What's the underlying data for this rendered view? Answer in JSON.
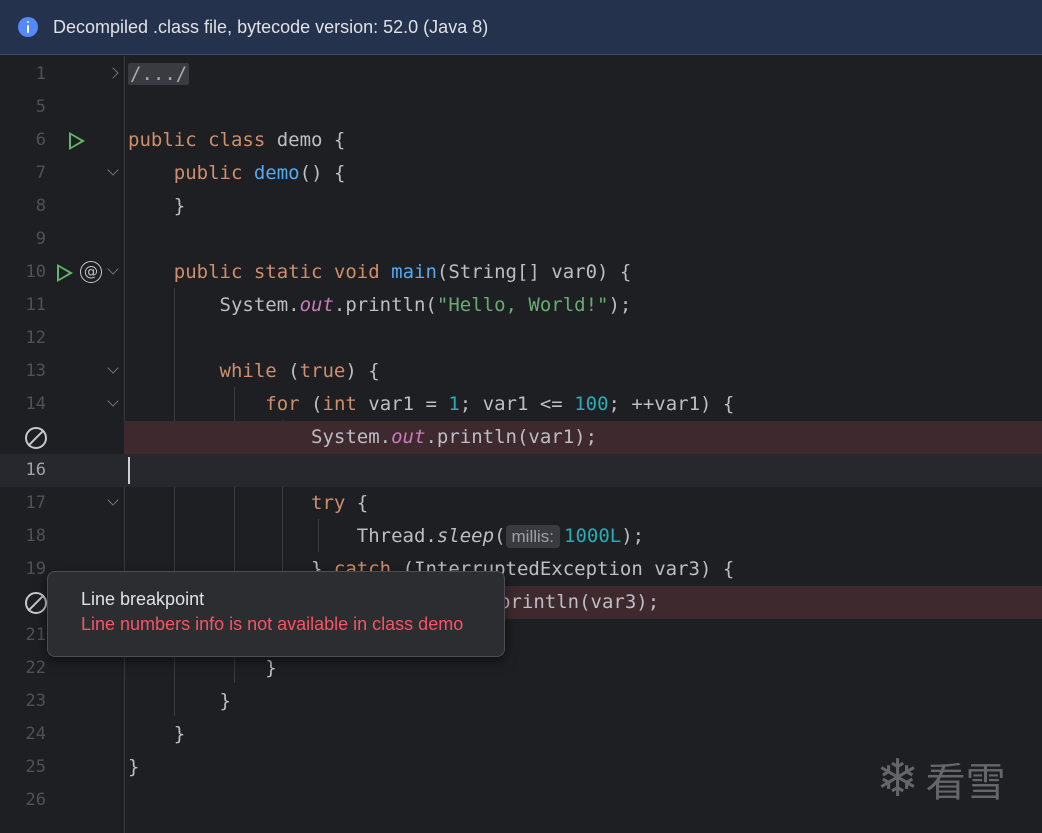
{
  "banner": {
    "text": "Decompiled .class file, bytecode version: 52.0 (Java 8)",
    "icon": "info-icon"
  },
  "lines": [
    {
      "n": "1"
    },
    {
      "n": "5"
    },
    {
      "n": "6"
    },
    {
      "n": "7"
    },
    {
      "n": "8"
    },
    {
      "n": "9"
    },
    {
      "n": "10"
    },
    {
      "n": "11"
    },
    {
      "n": "12"
    },
    {
      "n": "13"
    },
    {
      "n": "14"
    },
    {
      "n": ""
    },
    {
      "n": "16"
    },
    {
      "n": "17"
    },
    {
      "n": "18"
    },
    {
      "n": "19"
    },
    {
      "n": ""
    },
    {
      "n": "21"
    },
    {
      "n": "22"
    },
    {
      "n": "23"
    },
    {
      "n": "24"
    },
    {
      "n": "25"
    },
    {
      "n": "26"
    }
  ],
  "code": {
    "l1": "/.../",
    "l6_kw": "public class",
    "l6_rest": " demo {",
    "l7_kw": "public",
    "l7_fn": "demo",
    "l7_rest": "() {",
    "l8": "}",
    "l10_kw": "public static void",
    "l10_fn": "main",
    "l10_rest": "(String[] var0) {",
    "l11_a": "System.",
    "l11_out": "out",
    "l11_b": ".println(",
    "l11_str": "\"Hello, World!\"",
    "l11_c": ");",
    "l13_kw": "while",
    "l13_a": " (",
    "l13_true": "true",
    "l13_b": ") {",
    "l14_kw": "for",
    "l14_a": " (",
    "l14_int": "int",
    "l14_b": " var1 = ",
    "l14_n1": "1",
    "l14_c": "; var1 <= ",
    "l14_n2": "100",
    "l14_d": "; ++var1) {",
    "l15_a": "System.",
    "l15_out": "out",
    "l15_b": ".println(var1);",
    "l17_kw": "try",
    "l17_rest": " {",
    "l18_a": "Thread.",
    "l18_sleep": "sleep",
    "l18_b": "(",
    "l18_hint": "millis:",
    "l18_num": "1000L",
    "l18_c": ");",
    "l19_a": "} ",
    "l19_kw": "catch",
    "l19_b": " (InterruptedException var3) {",
    "l20": "println(var3);",
    "l22": "}",
    "l23": "}",
    "l24": "}",
    "l25": "}"
  },
  "tooltip": {
    "title": "Line breakpoint",
    "message": "Line numbers info is not available in class demo"
  },
  "watermark": {
    "icon": "snowflake-icon",
    "text": "看雪"
  },
  "colors": {
    "keyword": "#cf8e6d",
    "function": "#56a8f5",
    "string": "#6aab73",
    "number": "#2aacb8",
    "static_field": "#c77dbb",
    "breakpoint_line": "#3e2a2e",
    "error_text": "#f75464"
  }
}
